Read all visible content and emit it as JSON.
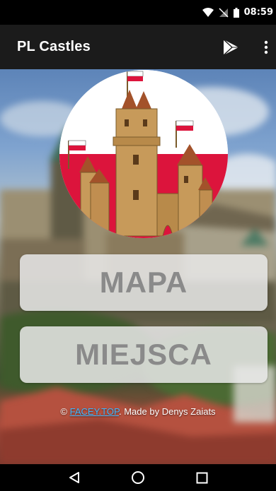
{
  "status_bar": {
    "time": "08:59"
  },
  "app_bar": {
    "title": "PL Castles"
  },
  "buttons": {
    "map_label": "MAPA",
    "places_label": "MIEJSCA"
  },
  "credit": {
    "prefix": "© ",
    "link_text": "FACEY.TOP",
    "suffix": ". Made by Denys Zaiats"
  },
  "icons": {
    "wifi": "wifi-icon",
    "signal": "signal-off-icon",
    "battery": "battery-icon",
    "play": "play-store-icon",
    "more": "more-vert-icon",
    "back": "back-icon",
    "home": "home-icon",
    "recents": "recents-icon"
  },
  "colors": {
    "app_bar": "#1b1b1b",
    "button_text": "#8a8a8a",
    "link": "#3eb8ff",
    "flag_red": "#dc143c"
  }
}
